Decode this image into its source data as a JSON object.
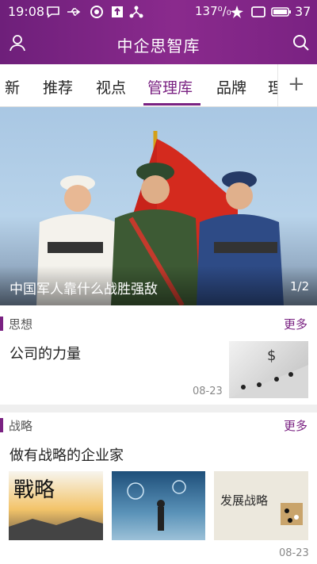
{
  "status": {
    "time": "19:08",
    "battery_pct": "137⁰/₀",
    "signal_level": "37"
  },
  "header": {
    "title": "中企思智库"
  },
  "tabs": [
    {
      "label": "新"
    },
    {
      "label": "推荐"
    },
    {
      "label": "视点"
    },
    {
      "label": "管理库",
      "active": true
    },
    {
      "label": "品牌"
    },
    {
      "label": "理"
    }
  ],
  "banner": {
    "caption": "中国军人靠什么战胜强敌",
    "pager": "1/2"
  },
  "sections": [
    {
      "name": "思想",
      "more": "更多",
      "article": {
        "title": "公司的力量",
        "date": "08-23"
      }
    },
    {
      "name": "战略",
      "more": "更多",
      "article": {
        "title": "做有战略的企业家",
        "date": "08-23"
      },
      "thumb_texts": [
        "戰略",
        "发展战略"
      ]
    }
  ],
  "colors": {
    "brand": "#7a2282",
    "header_gradient_start": "#6e1f7a",
    "header_gradient_end": "#8a2a8d"
  }
}
